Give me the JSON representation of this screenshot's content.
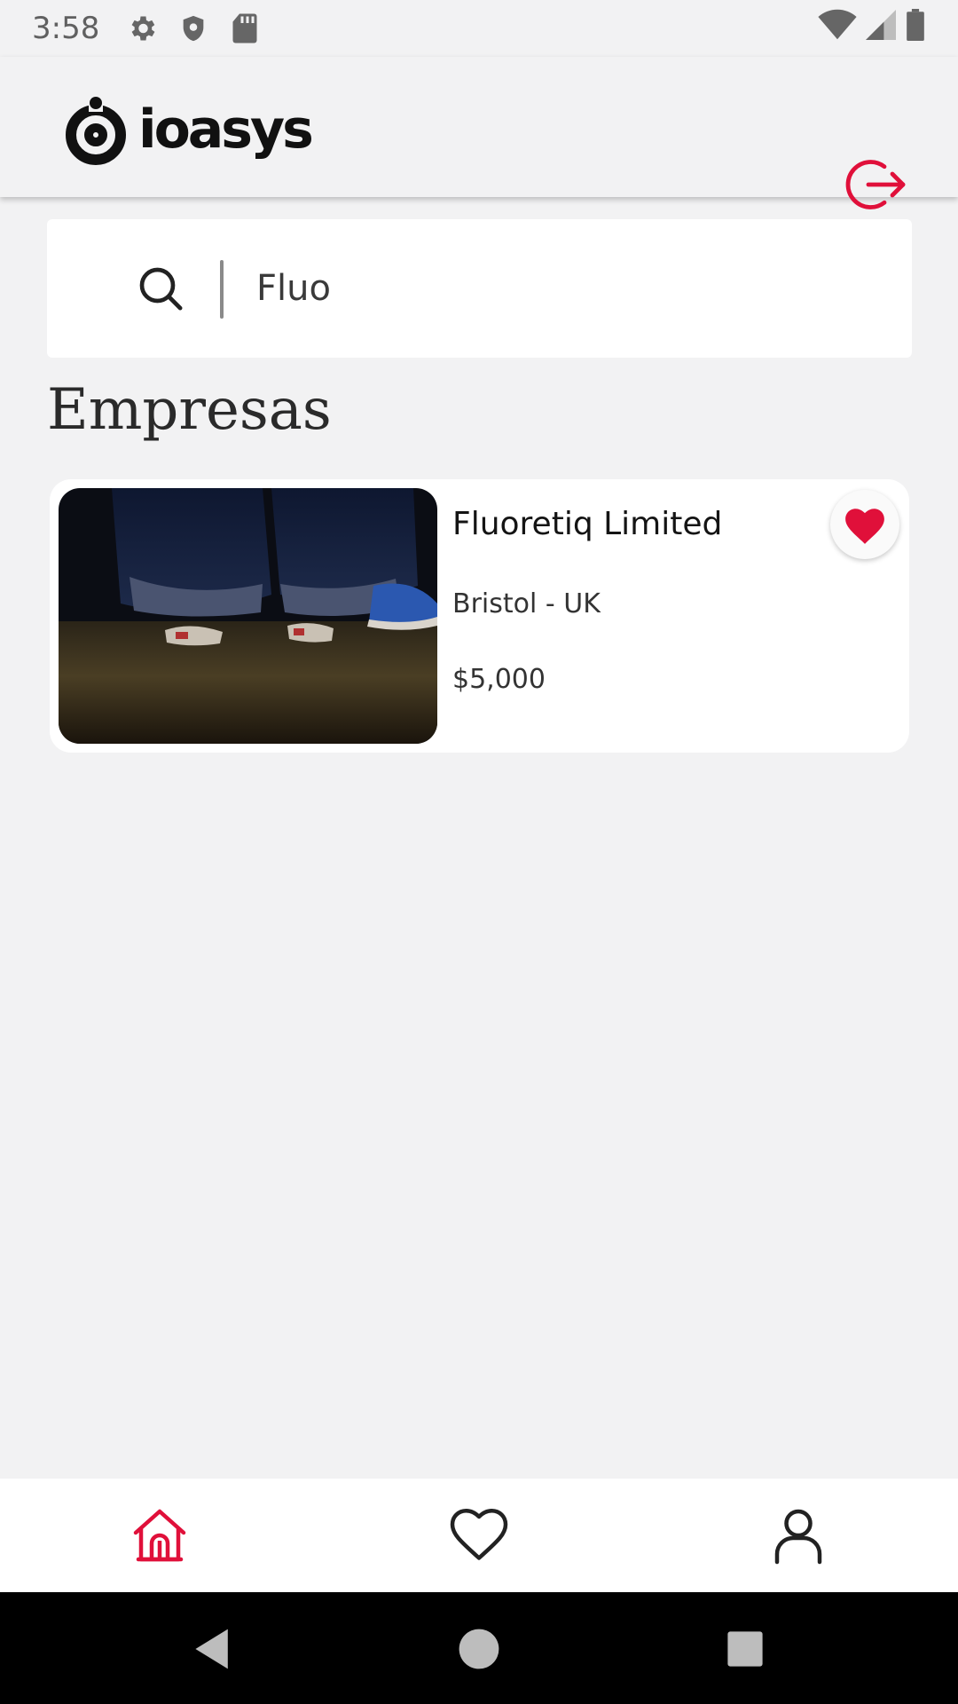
{
  "status_bar": {
    "time": "3:58",
    "icons": [
      "gear-icon",
      "shield-icon",
      "sd-card-icon",
      "wifi-icon",
      "cell-signal-icon",
      "battery-icon"
    ]
  },
  "header": {
    "logo_text": "ioasys",
    "logout_icon": "logout-icon"
  },
  "search": {
    "value": "Fluo",
    "icon": "search-icon"
  },
  "section": {
    "title": "Empresas"
  },
  "companies": [
    {
      "name": "Fluoretiq Limited",
      "location": "Bristol - UK",
      "price": "$5,000",
      "favorited": true
    }
  ],
  "bottom_nav": {
    "items": [
      "home-icon",
      "heart-icon",
      "user-icon"
    ],
    "active": "home-icon"
  },
  "colors": {
    "accent": "#e0103a",
    "background": "#f2f2f3",
    "card": "#ffffff"
  }
}
